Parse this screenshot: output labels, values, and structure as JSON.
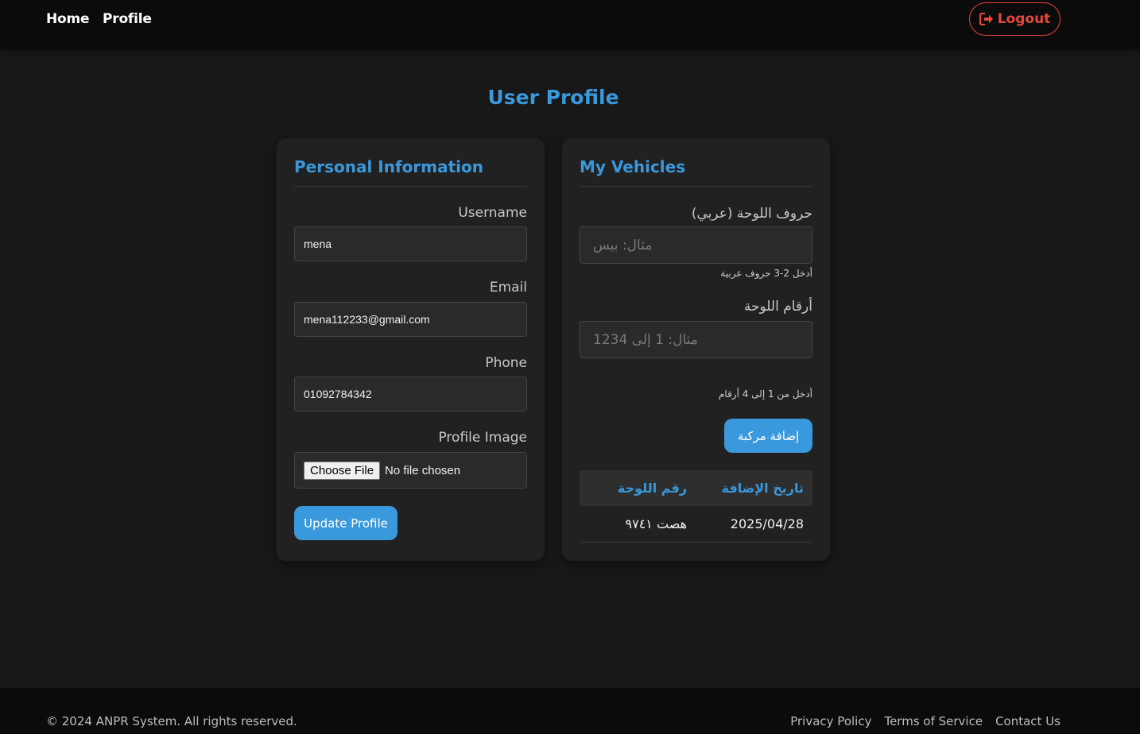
{
  "nav": {
    "home": "Home",
    "profile": "Profile",
    "logout": "Logout"
  },
  "page": {
    "title": "User Profile"
  },
  "personal": {
    "title": "Personal Information",
    "username_label": "Username",
    "username_value": "mena",
    "email_label": "Email",
    "email_value": "mena112233@gmail.com",
    "phone_label": "Phone",
    "phone_value": "01092784342",
    "image_label": "Profile Image",
    "file_button": "Choose File",
    "file_status": "No file chosen",
    "update_button": "Update Profile"
  },
  "vehicles": {
    "title": "My Vehicles",
    "letters_label": "حروف اللوحة (عربي)",
    "letters_placeholder": "مثال: بيس",
    "letters_hint": "أدخل 2-3 حروف عربية",
    "numbers_label": "أرقام اللوحة",
    "numbers_placeholder": "مثال: 1 إلى 1234",
    "numbers_hint": "أدخل من 1 إلى 4 أرقام",
    "add_button": "إضافة مركبة",
    "table": {
      "headers": [
        "تاريخ الإضافة",
        "رقم اللوحة"
      ],
      "rows": [
        {
          "date": "2025/04/28",
          "plate": "هصت ٩٧٤١"
        }
      ]
    }
  },
  "footer": {
    "copyright": "© 2024 ANPR System. All rights reserved.",
    "links": [
      "Privacy Policy",
      "Terms of Service",
      "Contact Us"
    ]
  },
  "colors": {
    "accent": "#3a98dc",
    "danger": "#e4483e",
    "background": "#181818",
    "card": "#212121",
    "navbar": "#0b0b0b"
  }
}
